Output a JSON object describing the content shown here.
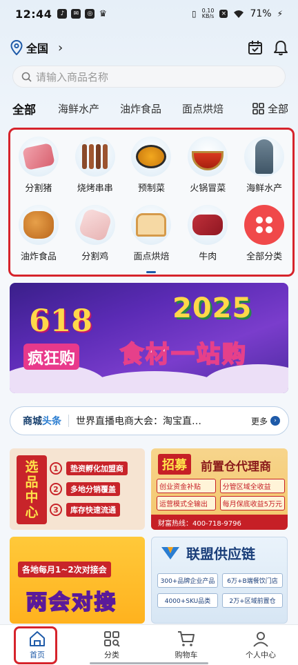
{
  "status_bar": {
    "time": "12:44",
    "net_rate": "0.10",
    "net_unit": "KB/s",
    "battery": "71%"
  },
  "location": {
    "name": "全国"
  },
  "search": {
    "placeholder": "请输入商品名称"
  },
  "tabs": [
    {
      "label": "全部",
      "active": true
    },
    {
      "label": "海鲜水产"
    },
    {
      "label": "油炸食品"
    },
    {
      "label": "面点烘焙"
    }
  ],
  "tabs_all_label": "全部",
  "categories": [
    {
      "label": "分割猪",
      "icon": "pork-cut-image"
    },
    {
      "label": "烧烤串串",
      "icon": "bbq-skewers-image"
    },
    {
      "label": "预制菜",
      "icon": "prepared-dish-image"
    },
    {
      "label": "火锅冒菜",
      "icon": "hotpot-image"
    },
    {
      "label": "海鲜水产",
      "icon": "seafood-fish-image"
    },
    {
      "label": "油炸食品",
      "icon": "fried-food-image"
    },
    {
      "label": "分割鸡",
      "icon": "chicken-cut-image"
    },
    {
      "label": "面点烘焙",
      "icon": "bread-image"
    },
    {
      "label": "牛肉",
      "icon": "beef-image"
    },
    {
      "label": "全部分类",
      "icon": "all-categories-icon"
    }
  ],
  "banner": {
    "num618": "618",
    "crazy": "疯狂购",
    "year": "2025",
    "slogan": "食材一站购"
  },
  "news": {
    "tag_part1": "商城",
    "tag_part2": "头条",
    "headline": "世界直播电商大会：淘宝直…",
    "more": "更多"
  },
  "promo1": {
    "vertical": [
      "选",
      "品",
      "中",
      "心"
    ],
    "rows": [
      {
        "num": "1",
        "text": "垫资孵化加盟商"
      },
      {
        "num": "2",
        "text": "多地分销覆盖"
      },
      {
        "num": "3",
        "text": "库存快速流通"
      }
    ]
  },
  "promo2": {
    "badge": "招募",
    "title": "前置仓代理商",
    "chips": [
      "创业资金补贴",
      "分管区域全收益",
      "运营模式全输出",
      "每月保底收益5万元"
    ],
    "hotline": "财富热线：400-718-9796"
  },
  "promo3": {
    "pill": "各地每月1~2次对接会",
    "big": "两会对接"
  },
  "promo4": {
    "title": "联盟供应链",
    "cells": [
      "300+品牌企业产品",
      "6万+B端餐饮门店",
      "4000+SKU品类",
      "2万+区域前置仓"
    ]
  },
  "bottom_nav": [
    {
      "label": "首页",
      "icon": "home-icon",
      "active": true
    },
    {
      "label": "分类",
      "icon": "category-grid-icon"
    },
    {
      "label": "购物车",
      "icon": "cart-icon"
    },
    {
      "label": "个人中心",
      "icon": "user-icon"
    }
  ],
  "colors": {
    "accent": "#1e5aa8",
    "highlight_box": "#d6232b"
  }
}
